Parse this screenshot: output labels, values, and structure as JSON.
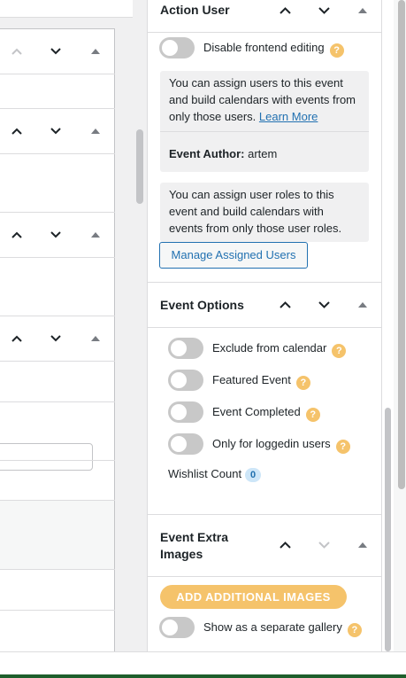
{
  "action_user": {
    "title": "Action User",
    "disable_editing_label": "Disable frontend editing",
    "info_users_text": "You can assign users to this event and build calendars with events from only those users.",
    "learn_more": "Learn More",
    "author_label": "Event Author:",
    "author_value": "artem",
    "info_roles_text": "You can assign user roles to this event and build calendars with events from only those user roles.",
    "manage_button": "Manage Assigned Users"
  },
  "event_options": {
    "title": "Event Options",
    "toggles": [
      {
        "label": "Exclude from calendar"
      },
      {
        "label": "Featured Event"
      },
      {
        "label": "Event Completed"
      },
      {
        "label": "Only for loggedin users"
      }
    ],
    "wishlist_label": "Wishlist Count",
    "wishlist_count": "0"
  },
  "extra_images": {
    "title_line1": "Event Extra",
    "title_line2": "Images",
    "add_button": "ADD ADDITIONAL IMAGES",
    "separate_gallery_label": "Show as a separate gallery"
  },
  "help_glyph": "?",
  "colors": {
    "accent_blue": "#2271b1",
    "help_orange": "#f5c36b",
    "toggle_off": "#c8c8c8",
    "badge_blue": "#cde6f8"
  },
  "icons": [
    "chevron-up-icon",
    "chevron-down-icon",
    "collapse-triangle-icon",
    "help-icon"
  ]
}
